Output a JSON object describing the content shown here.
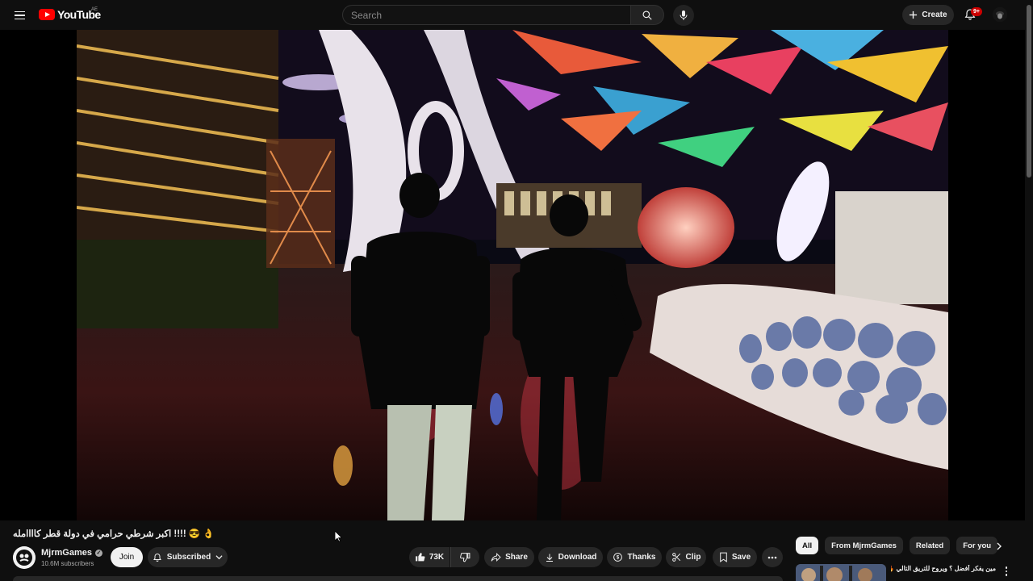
{
  "header": {
    "logo_text": "YouTube",
    "region": "AE",
    "search_placeholder": "Search",
    "create_label": "Create",
    "notification_badge": "9+"
  },
  "video": {
    "title": "اكبر شرطي حرامي في دولة قطر كاااامله !!!! 😎 👌"
  },
  "channel": {
    "name": "MjrmGames",
    "subscribers": "10.6M subscribers",
    "join_label": "Join",
    "subscribed_label": "Subscribed"
  },
  "actions": {
    "likes": "73K",
    "share": "Share",
    "download": "Download",
    "thanks": "Thanks",
    "clip": "Clip",
    "save": "Save"
  },
  "chips": [
    "All",
    "From MjrmGames",
    "Related",
    "For you"
  ],
  "recommendation": {
    "title": "مين يفكر أفضل ؟ ويروح للتريق التالي 🔥"
  },
  "colors": {
    "background": "#0f0f0f",
    "youtube_red": "#ff0000",
    "pill_bg": "#272727",
    "badge": "#cc0000"
  }
}
